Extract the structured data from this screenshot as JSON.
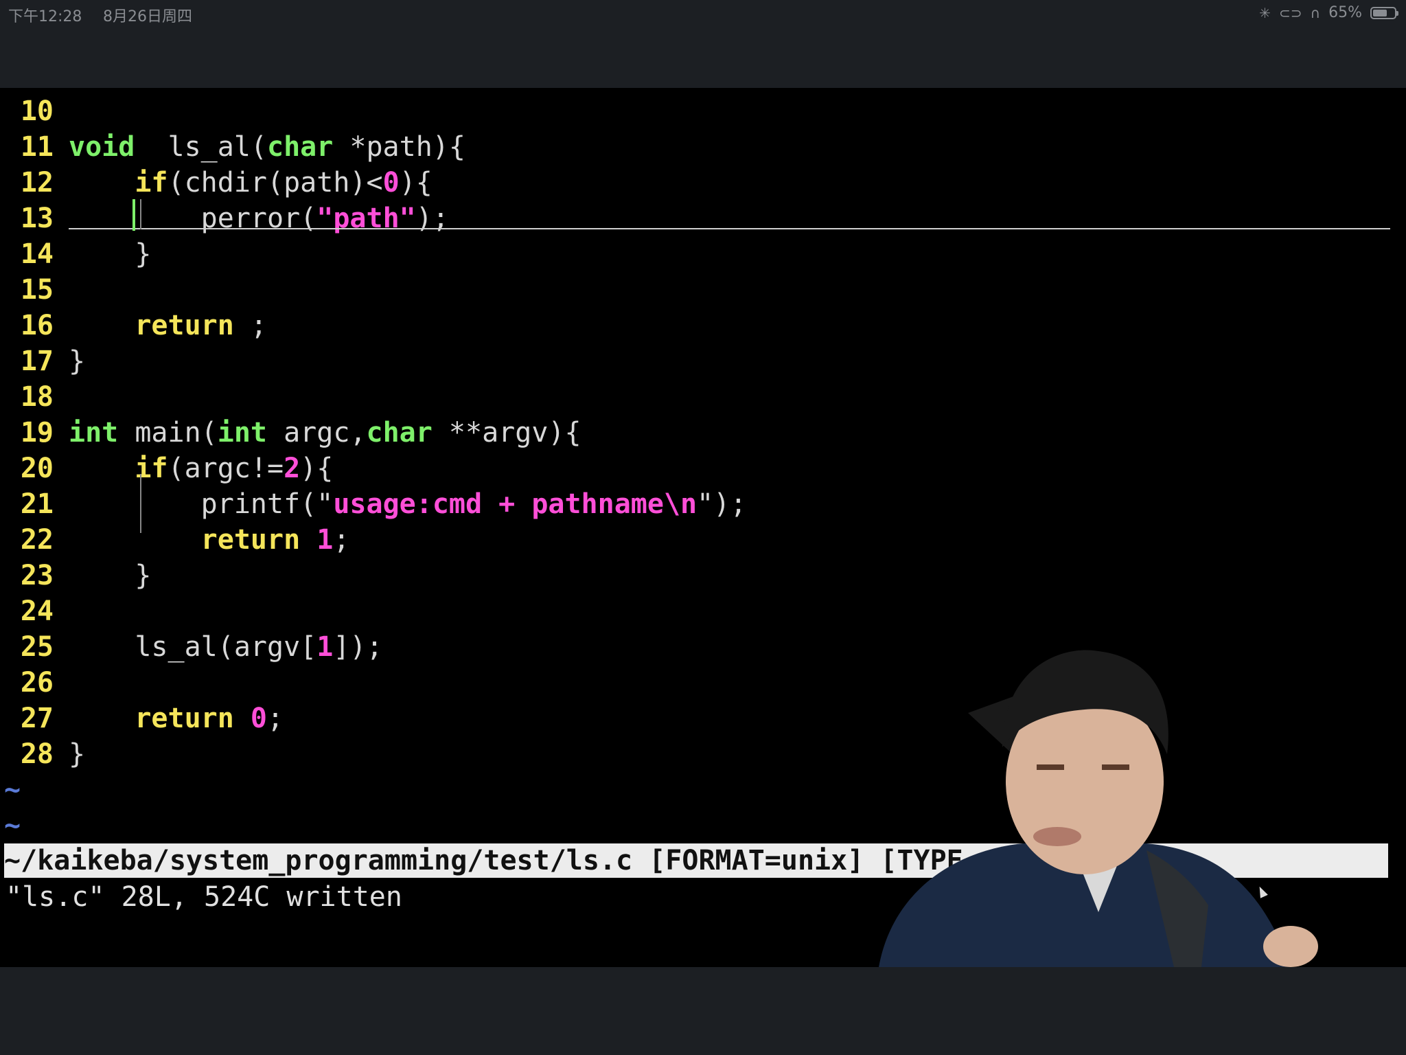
{
  "status_bar": {
    "time": "下午12:28",
    "date": "8月26日周四",
    "battery": "65%",
    "battery_level": 0.65
  },
  "editor": {
    "lines": [
      {
        "n": "10",
        "segs": []
      },
      {
        "n": "11",
        "segs": [
          [
            "ty",
            "void"
          ],
          [
            "",
            "  ls_al("
          ],
          [
            "ty",
            "char"
          ],
          [
            "",
            " *path){"
          ]
        ]
      },
      {
        "n": "12",
        "segs": [
          [
            "",
            "    "
          ],
          [
            "kw",
            "if"
          ],
          [
            "",
            "(chdir(path)<"
          ],
          [
            "num",
            "0"
          ],
          [
            "",
            "){"
          ]
        ]
      },
      {
        "n": "13",
        "segs": [
          [
            "",
            "        perror("
          ],
          [
            "str",
            "\"path\""
          ],
          [
            "",
            ");"
          ]
        ]
      },
      {
        "n": "14",
        "segs": [
          [
            "",
            "    }"
          ]
        ]
      },
      {
        "n": "15",
        "segs": []
      },
      {
        "n": "16",
        "segs": [
          [
            "",
            "    "
          ],
          [
            "kw",
            "return"
          ],
          [
            "",
            " ;"
          ]
        ]
      },
      {
        "n": "17",
        "segs": [
          [
            "",
            "}"
          ]
        ]
      },
      {
        "n": "18",
        "segs": []
      },
      {
        "n": "19",
        "segs": [
          [
            "ty",
            "int"
          ],
          [
            "",
            " main("
          ],
          [
            "ty",
            "int"
          ],
          [
            "",
            " argc,"
          ],
          [
            "ty",
            "char"
          ],
          [
            "",
            " **argv){"
          ]
        ]
      },
      {
        "n": "20",
        "segs": [
          [
            "",
            "    "
          ],
          [
            "kw",
            "if"
          ],
          [
            "",
            "(argc!="
          ],
          [
            "num",
            "2"
          ],
          [
            "",
            "){"
          ]
        ]
      },
      {
        "n": "21",
        "segs": [
          [
            "",
            "        printf("
          ],
          [
            "q",
            "\""
          ],
          [
            "str",
            "usage:cmd + pathname\\n"
          ],
          [
            "q",
            "\""
          ],
          [
            "",
            ");"
          ]
        ]
      },
      {
        "n": "22",
        "segs": [
          [
            "",
            "        "
          ],
          [
            "kw",
            "return"
          ],
          [
            "",
            " "
          ],
          [
            "num",
            "1"
          ],
          [
            "",
            ";"
          ]
        ]
      },
      {
        "n": "23",
        "segs": [
          [
            "",
            "    }"
          ]
        ]
      },
      {
        "n": "24",
        "segs": []
      },
      {
        "n": "25",
        "segs": [
          [
            "",
            "    ls_al(argv["
          ],
          [
            "num",
            "1"
          ],
          [
            "",
            "]);"
          ]
        ]
      },
      {
        "n": "26",
        "segs": []
      },
      {
        "n": "27",
        "segs": [
          [
            "",
            "    "
          ],
          [
            "kw",
            "return"
          ],
          [
            "",
            " "
          ],
          [
            "num",
            "0"
          ],
          [
            "",
            ";"
          ]
        ]
      },
      {
        "n": "28",
        "segs": [
          [
            "",
            "}"
          ]
        ]
      }
    ],
    "empty_marker": "~",
    "statusline": "~/kaikeba/system_programming/test/ls.c [FORMAT=unix] [TYPE",
    "message": "\"ls.c\" 28L, 524C written"
  }
}
